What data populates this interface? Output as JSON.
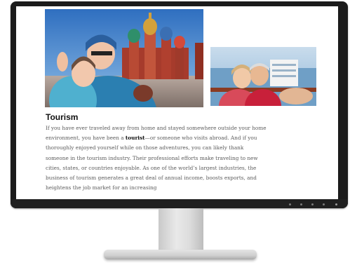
{
  "article": {
    "title": "Tourism",
    "body_part1": "If you have ever traveled away from home and stayed somewhere outside your home environment, you have been a ",
    "keyword": "tourist",
    "body_part2": "—or someone who visits abroad. And if you thoroughly enjoyed yourself while on those adventures, you can likely thank someone in the tourism industry. Their professional efforts make traveling to new cities, states, or countries enjoyable. As one of the world’s largest industries, the business of tourism generates a great deal of annual income, boosts exports, and heightens the job market for an increasing"
  },
  "images": {
    "main": "tourists-selfie-red-square-photo",
    "side": "couple-selfie-cruise-ship-photo"
  },
  "colors": {
    "bezel": "#1b1b1b",
    "title": "#111111",
    "body_text": "#5c5c5c",
    "stand": "#d9d9d9"
  }
}
